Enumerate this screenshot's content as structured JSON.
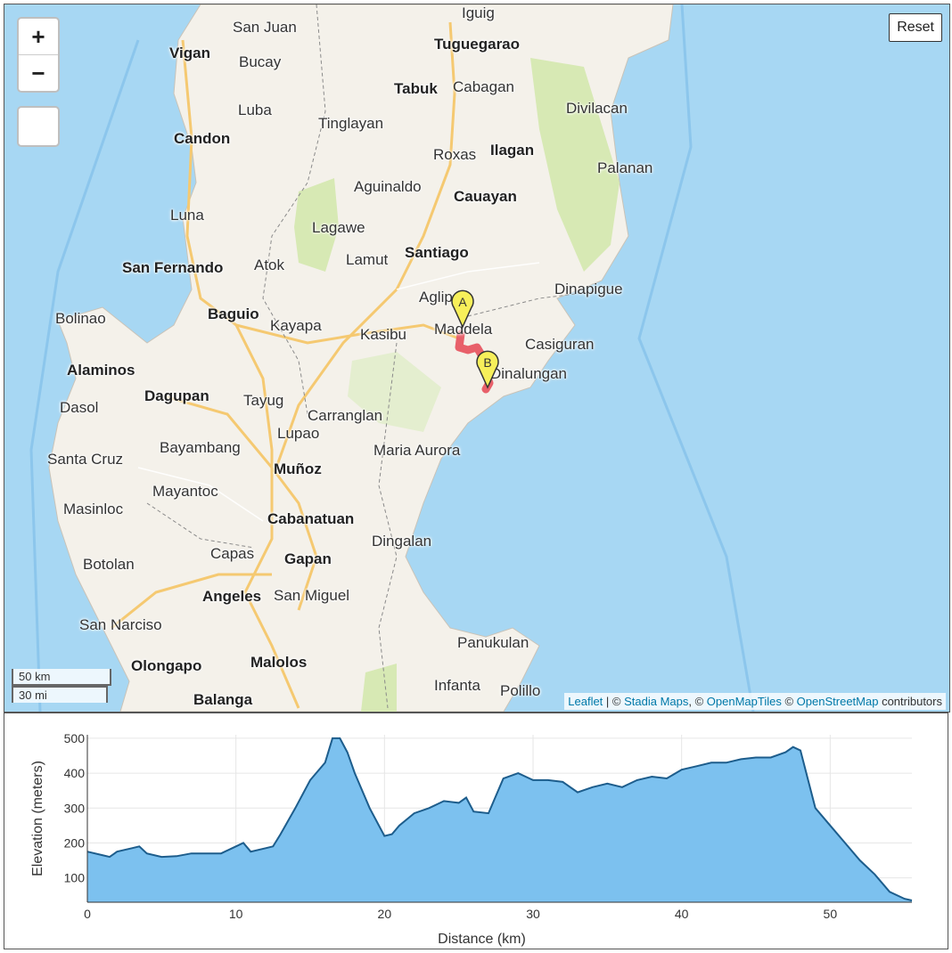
{
  "map": {
    "controls": {
      "zoom_in": "+",
      "zoom_out": "−",
      "reset": "Reset"
    },
    "scale": {
      "metric": "50 km",
      "imperial": "30 mi"
    },
    "attribution": {
      "leaflet": "Leaflet",
      "sep": " | © ",
      "stadia": "Stadia Maps",
      "c1": ", © ",
      "omt": "OpenMapTiles",
      "c2": " © ",
      "osm": "OpenStreetMap",
      "contrib": " contributors"
    },
    "markers": {
      "start": "A",
      "end": "B"
    },
    "colors": {
      "water": "#a7d7f3",
      "land": "#f4f1ea",
      "park": "#d7e9b4",
      "route": "#e8606a",
      "marker": "#f7ef5a",
      "road": "#f5c971"
    },
    "places": [
      {
        "name": "San Juan",
        "big": false
      },
      {
        "name": "Iguig",
        "big": false
      },
      {
        "name": "Tuguegarao",
        "big": true
      },
      {
        "name": "Vigan",
        "big": true
      },
      {
        "name": "Bucay",
        "big": false
      },
      {
        "name": "Tabuk",
        "big": true
      },
      {
        "name": "Cabagan",
        "big": false
      },
      {
        "name": "Divilacan",
        "big": false
      },
      {
        "name": "Luba",
        "big": false
      },
      {
        "name": "Tinglayan",
        "big": false
      },
      {
        "name": "Candon",
        "big": true
      },
      {
        "name": "Roxas",
        "big": false
      },
      {
        "name": "Ilagan",
        "big": true
      },
      {
        "name": "Palanan",
        "big": false
      },
      {
        "name": "Aguinaldo",
        "big": false
      },
      {
        "name": "Cauayan",
        "big": true
      },
      {
        "name": "Luna",
        "big": false
      },
      {
        "name": "Lagawe",
        "big": false
      },
      {
        "name": "San Fernando",
        "big": true
      },
      {
        "name": "Atok",
        "big": false
      },
      {
        "name": "Lamut",
        "big": false
      },
      {
        "name": "Santiago",
        "big": true
      },
      {
        "name": "Dinapigue",
        "big": false
      },
      {
        "name": "Aglip",
        "big": false
      },
      {
        "name": "Bolinao",
        "big": false
      },
      {
        "name": "Baguio",
        "big": true
      },
      {
        "name": "Kayapa",
        "big": false
      },
      {
        "name": "Kasibu",
        "big": false
      },
      {
        "name": "Maddela",
        "big": false
      },
      {
        "name": "Casiguran",
        "big": false
      },
      {
        "name": "Alaminos",
        "big": true
      },
      {
        "name": "Dinalungan",
        "big": false
      },
      {
        "name": "Dagupan",
        "big": true
      },
      {
        "name": "Tayug",
        "big": false
      },
      {
        "name": "Dasol",
        "big": false
      },
      {
        "name": "Carranglan",
        "big": false
      },
      {
        "name": "Lupao",
        "big": false
      },
      {
        "name": "Bayambang",
        "big": false
      },
      {
        "name": "Maria Aurora",
        "big": false
      },
      {
        "name": "Santa Cruz",
        "big": false
      },
      {
        "name": "Muñoz",
        "big": true
      },
      {
        "name": "Mayantoc",
        "big": false
      },
      {
        "name": "Masinloc",
        "big": false
      },
      {
        "name": "Cabanatuan",
        "big": true
      },
      {
        "name": "Dingalan",
        "big": false
      },
      {
        "name": "Botolan",
        "big": false
      },
      {
        "name": "Capas",
        "big": false
      },
      {
        "name": "Gapan",
        "big": true
      },
      {
        "name": "Angeles",
        "big": true
      },
      {
        "name": "San Miguel",
        "big": false
      },
      {
        "name": "San Narciso",
        "big": false
      },
      {
        "name": "Panukulan",
        "big": false
      },
      {
        "name": "Olongapo",
        "big": true
      },
      {
        "name": "Malolos",
        "big": true
      },
      {
        "name": "Infanta",
        "big": false
      },
      {
        "name": "Polillo",
        "big": false
      },
      {
        "name": "Balanga",
        "big": true
      }
    ]
  },
  "chart_data": {
    "type": "area",
    "xlabel": "Distance (km)",
    "ylabel": "Elevation (meters)",
    "xlim": [
      0,
      55.5
    ],
    "ylim": [
      30,
      510
    ],
    "xticks": [
      "0",
      "10",
      "20",
      "30",
      "40",
      "50"
    ],
    "yticks": [
      "100",
      "200",
      "300",
      "400",
      "500"
    ],
    "grid": true,
    "color": "#7cc1ef",
    "line_color": "#1d5d8c",
    "x": [
      0,
      1,
      1.5,
      2,
      3,
      3.5,
      4,
      5,
      6,
      7,
      8,
      9,
      10,
      10.5,
      11,
      12,
      12.5,
      13,
      14,
      15,
      16,
      16.5,
      17,
      17.5,
      18,
      19,
      20,
      20.5,
      21,
      22,
      23,
      24,
      25,
      25.5,
      26,
      27,
      28,
      29,
      30,
      31,
      32,
      33,
      34,
      35,
      36,
      37,
      38,
      39,
      40,
      41,
      42,
      43,
      44,
      45,
      46,
      47,
      47.5,
      48,
      49,
      50,
      51,
      52,
      53,
      54,
      55,
      55.5
    ],
    "y": [
      175,
      165,
      160,
      175,
      185,
      190,
      170,
      160,
      162,
      170,
      170,
      170,
      190,
      200,
      175,
      185,
      190,
      225,
      300,
      380,
      430,
      500,
      500,
      460,
      400,
      300,
      220,
      225,
      250,
      285,
      300,
      320,
      315,
      330,
      290,
      285,
      385,
      400,
      380,
      380,
      375,
      345,
      360,
      370,
      360,
      380,
      390,
      385,
      410,
      420,
      430,
      430,
      440,
      445,
      445,
      460,
      475,
      465,
      300,
      250,
      200,
      150,
      110,
      60,
      40,
      35
    ]
  }
}
